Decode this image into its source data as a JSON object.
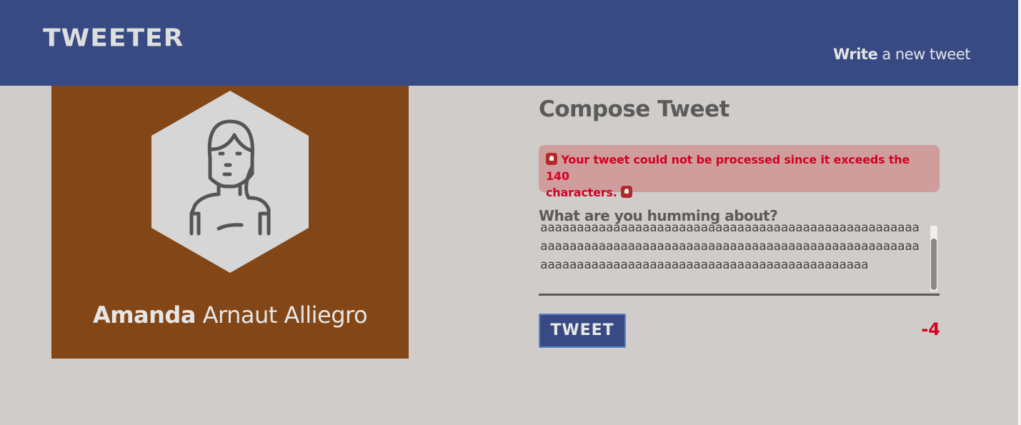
{
  "app": {
    "brand": "TWEETER"
  },
  "nav": {
    "write_bold": "Write",
    "write_rest": " a new tweet"
  },
  "profile": {
    "first_name": "Amanda",
    "last_name": " Arnaut Alliegro",
    "avatar_icon": "woman-avatar-icon"
  },
  "compose": {
    "title": "Compose Tweet",
    "error_message_line1": "Your tweet could not be processed since it exceeds the 140",
    "error_message_line2": "characters.",
    "error_icon": "siren-icon",
    "prompt_label": "What are you humming about?",
    "textarea_value": "aaaaaaaaaaaaaaaaaaaaaaaaaaaaaaaaaaaaaaaaaaaaaaaaaaaaaaaaaaaaaaaaaaaaaaaaaaaaaaaaaaaaaaaaaaaaaaaaaaaaaaaaaaaaaaaaaaaaaaaaaaaaaaaaaaaaaaaaaaaaaaaaaaaaa",
    "tweet_button_label": "TWEET",
    "char_counter": "-4"
  },
  "colors": {
    "navbar": "#374a83",
    "page_background": "#cfccc9",
    "profile_background": "#834717",
    "error_background": "#d09d9d",
    "error_text": "#d40022"
  }
}
